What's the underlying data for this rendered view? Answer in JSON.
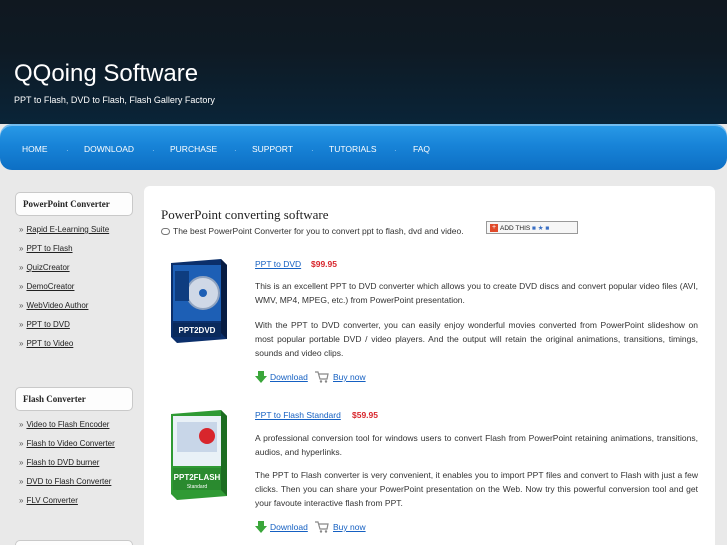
{
  "header": {
    "title": "QQoing Software",
    "tagline": "PPT to Flash, DVD to Flash, Flash Gallery Factory"
  },
  "nav": {
    "items": [
      "HOME",
      "DOWNLOAD",
      "PURCHASE",
      "SUPPORT",
      "TUTORIALS",
      "FAQ"
    ]
  },
  "sidebar": {
    "sections": [
      {
        "title": "PowerPoint Converter",
        "links": [
          "Rapid E-Learning Suite",
          "PPT to Flash",
          "QuizCreator",
          "DemoCreator",
          "WebVideo Author",
          "PPT to DVD",
          "PPT to Video"
        ]
      },
      {
        "title": "Flash Converter",
        "links": [
          "Video to Flash Encoder",
          "Flash to Video Converter",
          "Flash to DVD burner",
          "DVD to Flash Converter",
          "FLV Converter"
        ]
      }
    ]
  },
  "main": {
    "title": "PowerPoint converting software",
    "subtitle": "The best PowerPoint Converter for you to convert ppt to flash, dvd and video.",
    "addthis_label": "ADD THIS",
    "products": [
      {
        "name": "PPT to DVD",
        "price": "$99.95",
        "box_label": "PPT2DVD",
        "desc1": "This is an excellent PPT to DVD converter which allows you to create DVD discs and convert popular video files (AVI, WMV, MP4, MPEG, etc.) from PowerPoint presentation.",
        "desc2": "With the PPT to DVD converter, you can easily enjoy wonderful movies converted from PowerPoint slideshow on most popular portable DVD / video players. And the output will retain the original animations, transitions, timings, sounds and video clips.",
        "download": "Download",
        "buy": "Buy now"
      },
      {
        "name": "PPT to Flash Standard",
        "price": "$59.95",
        "box_label": "PPT2FLASH",
        "box_sublabel": "Standard",
        "desc1": "A professional conversion tool for windows users to convert Flash from PowerPoint retaining animations, transitions, audios, and hyperlinks.",
        "desc2": "The PPT to Flash converter is very convenient, it enables you to import PPT files and convert to Flash with just a few clicks. Then you can share your PowerPoint presentation on the Web. Now try this powerful conversion tool and get your favoute interactive flash from PPT.",
        "download": "Download",
        "buy": "Buy now"
      }
    ]
  },
  "colors": {
    "header_bg": "#0e1a24",
    "nav_bg": "#1884d8",
    "link": "#1560c2",
    "price": "#d8262c"
  }
}
